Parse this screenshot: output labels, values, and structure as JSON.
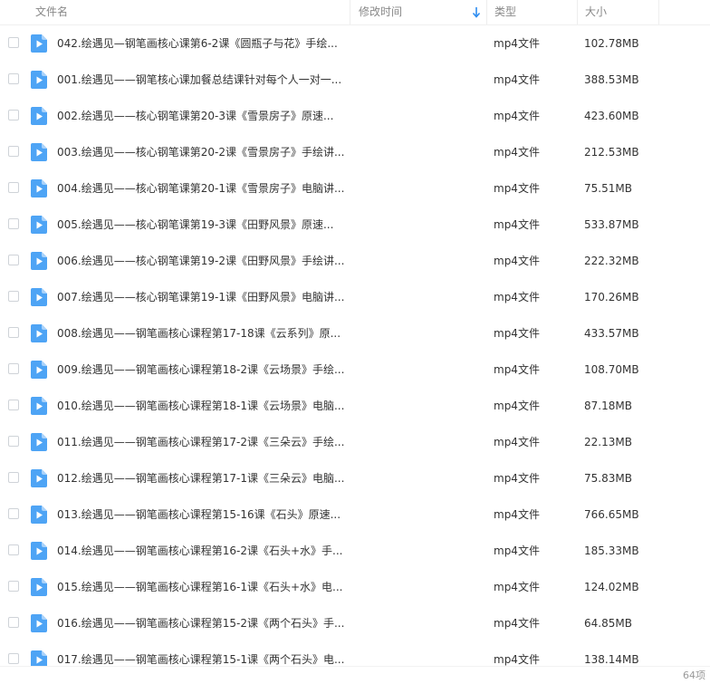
{
  "header": {
    "name": "文件名",
    "modified": "修改时间",
    "type": "类型",
    "size": "大小"
  },
  "colors": {
    "accent": "#2d8cf0",
    "file_icon": "#4ea4f5",
    "text": "#333333",
    "muted": "#888888"
  },
  "files": [
    {
      "name": "042.绘遇见—钢笔画核心课第6-2课《圆瓶子与花》手绘...",
      "type": "mp4文件",
      "size": "102.78MB"
    },
    {
      "name": "001.绘遇见——钢笔核心课加餐总结课针对每个人一对一...",
      "type": "mp4文件",
      "size": "388.53MB"
    },
    {
      "name": "002.绘遇见——核心钢笔课第20-3课《雪景房子》原速...",
      "type": "mp4文件",
      "size": "423.60MB"
    },
    {
      "name": "003.绘遇见——核心钢笔课第20-2课《雪景房子》手绘讲...",
      "type": "mp4文件",
      "size": "212.53MB"
    },
    {
      "name": "004.绘遇见——核心钢笔课第20-1课《雪景房子》电脑讲...",
      "type": "mp4文件",
      "size": "75.51MB"
    },
    {
      "name": "005.绘遇见——核心钢笔课第19-3课《田野风景》原速...",
      "type": "mp4文件",
      "size": "533.87MB"
    },
    {
      "name": "006.绘遇见——核心钢笔课第19-2课《田野风景》手绘讲...",
      "type": "mp4文件",
      "size": "222.32MB"
    },
    {
      "name": "007.绘遇见——核心钢笔课第19-1课《田野风景》电脑讲...",
      "type": "mp4文件",
      "size": "170.26MB"
    },
    {
      "name": "008.绘遇见——钢笔画核心课程第17-18课《云系列》原...",
      "type": "mp4文件",
      "size": "433.57MB"
    },
    {
      "name": "009.绘遇见——钢笔画核心课程第18-2课《云场景》手绘...",
      "type": "mp4文件",
      "size": "108.70MB"
    },
    {
      "name": "010.绘遇见——钢笔画核心课程第18-1课《云场景》电脑...",
      "type": "mp4文件",
      "size": "87.18MB"
    },
    {
      "name": "011.绘遇见——钢笔画核心课程第17-2课《三朵云》手绘...",
      "type": "mp4文件",
      "size": "22.13MB"
    },
    {
      "name": "012.绘遇见——钢笔画核心课程第17-1课《三朵云》电脑...",
      "type": "mp4文件",
      "size": "75.83MB"
    },
    {
      "name": "013.绘遇见——钢笔画核心课程第15-16课《石头》原速...",
      "type": "mp4文件",
      "size": "766.65MB"
    },
    {
      "name": "014.绘遇见——钢笔画核心课程第16-2课《石头+水》手...",
      "type": "mp4文件",
      "size": "185.33MB"
    },
    {
      "name": "015.绘遇见——钢笔画核心课程第16-1课《石头+水》电...",
      "type": "mp4文件",
      "size": "124.02MB"
    },
    {
      "name": "016.绘遇见——钢笔画核心课程第15-2课《两个石头》手...",
      "type": "mp4文件",
      "size": "64.85MB"
    },
    {
      "name": "017.绘遇见——钢笔画核心课程第15-1课《两个石头》电...",
      "type": "mp4文件",
      "size": "138.14MB"
    }
  ],
  "footer": {
    "count": "64项"
  }
}
